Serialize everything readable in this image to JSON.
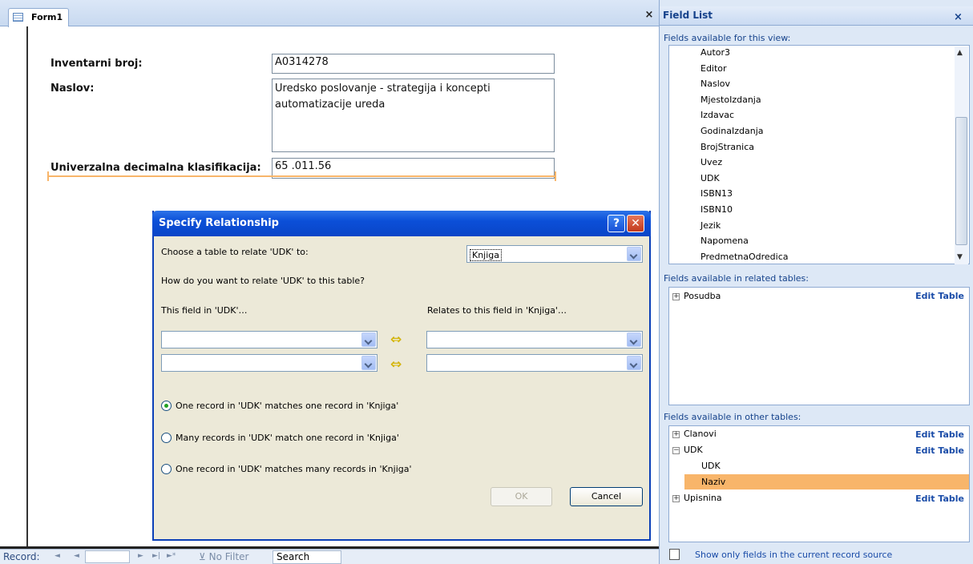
{
  "form": {
    "tab_title": "Form1",
    "close_glyph": "×",
    "fields": [
      {
        "label": "Inventarni broj:",
        "value": "A0314278"
      },
      {
        "label": "Naslov:",
        "value": "Uredsko poslovanje - strategija i koncepti automatizacije ureda"
      },
      {
        "label": "Univerzalna decimalna klasifikacija:",
        "value": "65 .011.56"
      }
    ]
  },
  "record_nav": {
    "record_label": "Record:",
    "first_glyph": "◄",
    "prev_glyph": "◄",
    "next_glyph": "►",
    "last_glyph": "►|",
    "new_glyph": "►*",
    "filter_label": "No Filter",
    "search_label": "Search"
  },
  "dialog": {
    "title": "Specify Relationship",
    "help_glyph": "?",
    "close_glyph": "✕",
    "choose_prompt": "Choose a table to relate 'UDK' to:",
    "selected_table": "Knjiga",
    "how_prompt": "How do you want to relate 'UDK' to this table?",
    "left_header": "This field in 'UDK'…",
    "right_header": "Relates to this field in 'Knjiga'…",
    "arrow_glyph": "⇔",
    "options": [
      {
        "label": "One record in 'UDK' matches one record in 'Knjiga'",
        "selected": true
      },
      {
        "label": "Many records in 'UDK' match one record in 'Knjiga'",
        "selected": false
      },
      {
        "label": "One record in 'UDK' matches many records in 'Knjiga'",
        "selected": false
      }
    ],
    "ok_label": "OK",
    "cancel_label": "Cancel"
  },
  "field_list": {
    "title": "Field List",
    "close_glyph": "×",
    "view_section": "Fields available for this view:",
    "view_fields": [
      "Autor3",
      "Editor",
      "Naslov",
      "MjestoIzdanja",
      "Izdavac",
      "GodinaIzdanja",
      "BrojStranica",
      "Uvez",
      "UDK",
      "ISBN13",
      "ISBN10",
      "Jezik",
      "Napomena",
      "PredmetnaOdredica"
    ],
    "related_section": "Fields available in related tables:",
    "related_tables": [
      {
        "name": "Posudba",
        "expander": "+",
        "edit": "Edit Table"
      }
    ],
    "other_section": "Fields available in other tables:",
    "other_tables": [
      {
        "name": "Clanovi",
        "expander": "+",
        "edit": "Edit Table"
      },
      {
        "name": "UDK",
        "expander": "−",
        "edit": "Edit Table"
      },
      {
        "name": "Upisnina",
        "expander": "+",
        "edit": "Edit Table"
      }
    ],
    "udk_fields": [
      "UDK",
      "Naziv"
    ],
    "selected_field": "Naziv",
    "footer_link": "Show only fields in the current record source"
  },
  "colors": {
    "accent_orange": "#f8b56a",
    "dialog_title_blue": "#0b4fd8",
    "link_blue": "#1a4ca8"
  }
}
